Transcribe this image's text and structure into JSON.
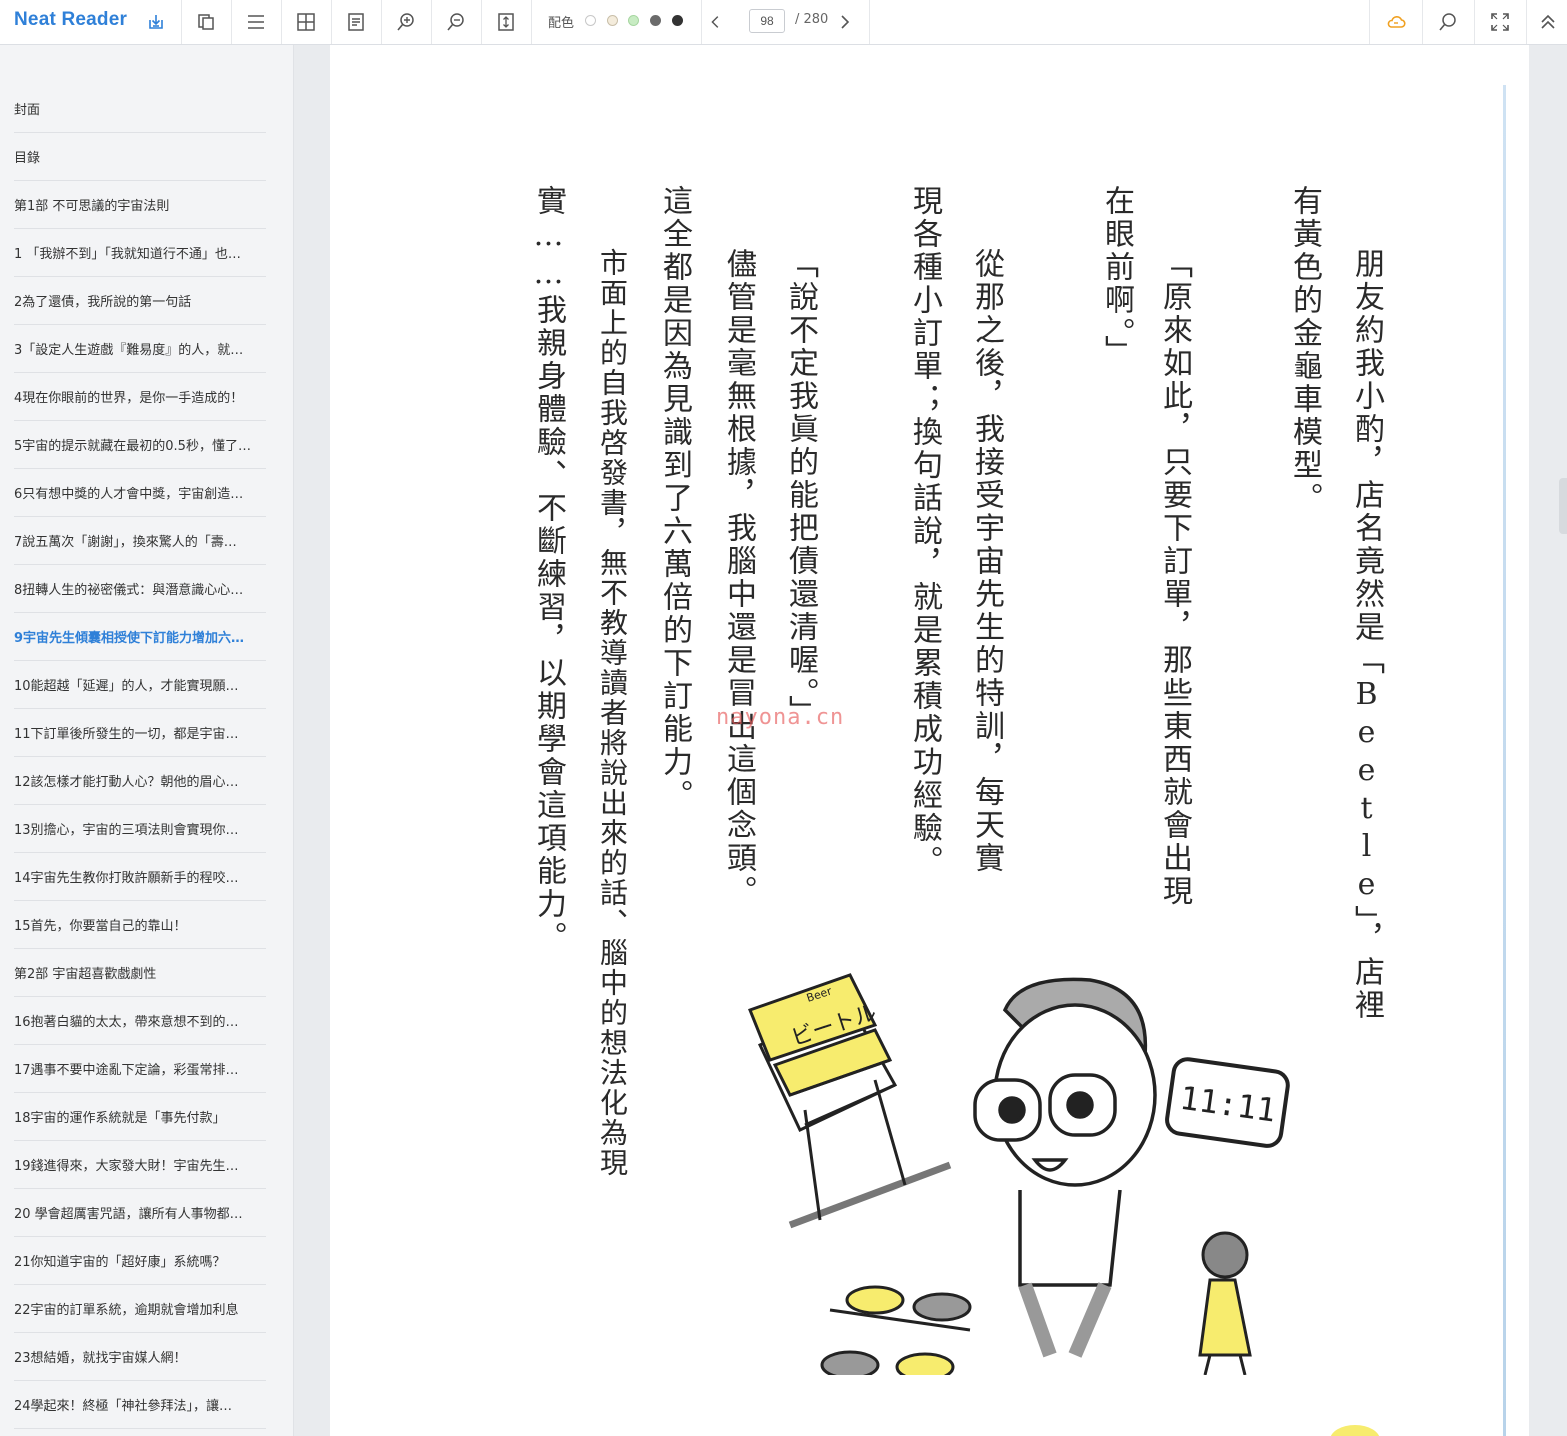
{
  "app": {
    "name": "Neat Reader",
    "brand_color": "#2f80d8"
  },
  "toolbar": {
    "color_scheme_label": "配色",
    "swatches": [
      "#ffffff",
      "#f4ecdc",
      "#c8ecc3",
      "#6b6b6b",
      "#333333"
    ],
    "current_page": "98",
    "total_pages": "/ 280",
    "icons": [
      "download-icon",
      "copy-icon",
      "menu-icon",
      "grid-icon",
      "notes-icon",
      "zoom-in-icon",
      "zoom-out-icon",
      "fit-height-icon",
      "chevron-left-icon",
      "chevron-right-icon",
      "cloud-icon",
      "search-icon",
      "fullscreen-icon",
      "collapse-up-icon"
    ]
  },
  "sidebar": {
    "items": [
      {
        "label": "封面"
      },
      {
        "label": "目錄"
      },
      {
        "label": "第1部 不可思議的宇宙法則"
      },
      {
        "label": "1 「我辦不到」「我就知道行不通」也…"
      },
      {
        "label": "2為了還債，我所說的第一句話"
      },
      {
        "label": "3「設定人生遊戲『難易度』的人，就…"
      },
      {
        "label": "4現在你眼前的世界，是你一手造成的！"
      },
      {
        "label": "5宇宙的提示就藏在最初的0.5秒，懂了…"
      },
      {
        "label": "6只有想中獎的人才會中獎，宇宙創造…"
      },
      {
        "label": "7說五萬次「謝謝」，換來驚人的「壽…"
      },
      {
        "label": "8扭轉人生的祕密儀式：與潛意識心心…"
      },
      {
        "label": "9宇宙先生傾囊相授使下訂能力增加六…"
      },
      {
        "label": "10能超越「延遲」的人，才能實現願…"
      },
      {
        "label": "11下訂單後所發生的一切，都是宇宙…"
      },
      {
        "label": "12該怎樣才能打動人心？朝他的眉心…"
      },
      {
        "label": "13別擔心，宇宙的三項法則會實現你…"
      },
      {
        "label": "14宇宙先生教你打敗許願新手的程咬…"
      },
      {
        "label": "15首先，你要當自己的靠山！"
      },
      {
        "label": "第2部 宇宙超喜歡戲劇性"
      },
      {
        "label": "16抱著白貓的太太，帶來意想不到的…"
      },
      {
        "label": "17遇事不要中途亂下定論，彩蛋常排…"
      },
      {
        "label": "18宇宙的運作系統就是「事先付款」"
      },
      {
        "label": "19錢進得來，大家發大財！宇宙先生…"
      },
      {
        "label": "20 學會超厲害咒語，讓所有人事物都…"
      },
      {
        "label": "21你知道宇宙的「超好康」系統嗎？"
      },
      {
        "label": "22宇宙的訂單系統，逾期就會增加利息"
      },
      {
        "label": "23想結婚，就找宇宙媒人網！"
      },
      {
        "label": "24學起來！終極「神社參拜法」，讓…"
      }
    ],
    "active_index": 11
  },
  "content": {
    "columns": [
      "朋友約我小酌，店名竟然是「Beetle」，店裡",
      "有黃色的金龜車模型。",
      "「原來如此，只要下訂單，那些東西就會出現",
      "在眼前啊。」",
      "從那之後，我接受宇宙先生的特訓，每天實",
      "現各種小訂單；換句話說，就是累積成功經驗。",
      "「說不定我眞的能把債還清喔。」",
      "儘管是毫無根據，我腦中還是冒出這個念頭。",
      "這全都是因為見識到了六萬倍的下訂能力。",
      "市面上的自我啓發書，無不教導讀者將說出來的話、腦中的想法化為現",
      "實……我親身體驗、不斷練習，以期學會這項能力。"
    ],
    "watermark": "nayona.cn",
    "illustration": {
      "shop_sign": "ビートル",
      "shop_sign_small": "Beer",
      "clock_time": "11:11"
    }
  }
}
